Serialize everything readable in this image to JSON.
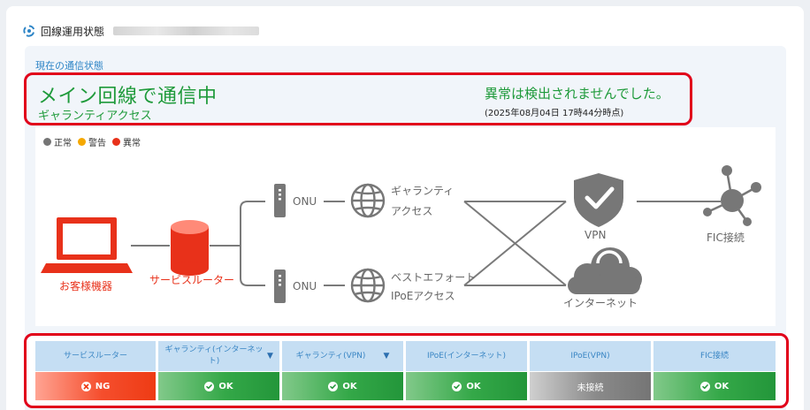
{
  "header": {
    "title": "回線運用状態"
  },
  "current": {
    "label": "現在の通信状態",
    "main_status": "メイン回線で通信中",
    "sub_status": "ギャランティアクセス",
    "anomaly_text": "異常は検出されませんでした。",
    "timestamp": "(2025年08月04日 17時44分時点)"
  },
  "legend": [
    {
      "label": "正常",
      "color": "#757575"
    },
    {
      "label": "警告",
      "color": "#f5a800"
    },
    {
      "label": "異常",
      "color": "#e8311a"
    }
  ],
  "diagram": {
    "customer": "お客様機器",
    "router": "サービスルーター",
    "onu_top": "ONU",
    "onu_bottom": "ONU",
    "guarantee_line1": "ギャランティ",
    "guarantee_line2": "アクセス",
    "besteffort_line1": "ベストエフォート",
    "besteffort_line2": "IPoEアクセス",
    "vpn": "VPN",
    "internet": "インターネット",
    "fic": "FIC接続"
  },
  "colors": {
    "ok": "#23963a",
    "ng": "#ee3b14",
    "neutral": "#757575",
    "accent": "#2c84c6",
    "alert_border": "#e1001a"
  },
  "status_table": {
    "columns": [
      {
        "header": "サービスルーター",
        "status": "NG",
        "state": "ng"
      },
      {
        "header": "ギャランティ(インターネット)",
        "status": "OK",
        "state": "ok",
        "dropdown": true
      },
      {
        "header": "ギャランティ(VPN)",
        "status": "OK",
        "state": "ok",
        "dropdown": true
      },
      {
        "header": "IPoE(インターネット)",
        "status": "OK",
        "state": "ok"
      },
      {
        "header": "IPoE(VPN)",
        "status": "未接続",
        "state": "gray"
      },
      {
        "header": "FIC接続",
        "status": "OK",
        "state": "ok"
      }
    ]
  }
}
